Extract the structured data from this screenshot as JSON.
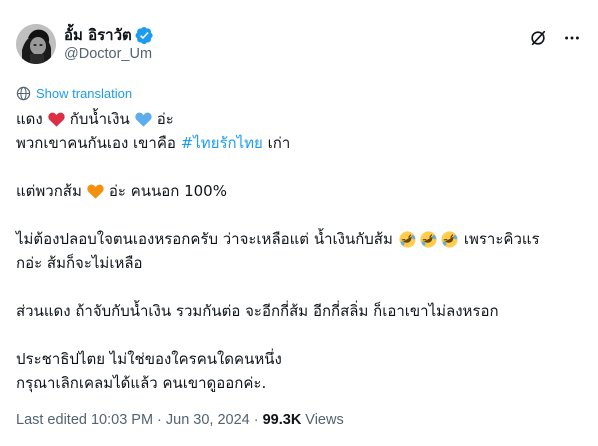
{
  "author": {
    "display_name": "อั้ม อิราวัต",
    "handle": "@Doctor_Um"
  },
  "header_icons": [
    "verified-badge-icon",
    "grok-icon",
    "more-icon"
  ],
  "translate": {
    "label": "Show translation",
    "icon": "globe-icon"
  },
  "body": {
    "line1": {
      "a": "แดง",
      "b": "กับน้ำเงิน",
      "c": "อ่ะ"
    },
    "line2": {
      "a": "พวกเขาคนกันเอง เขาคือ",
      "hashtag": "#ไทยรักไทย",
      "b": "เก่า"
    },
    "line3": {
      "a": "แต่พวกส้ม",
      "b": "อ่ะ คนนอก 100%"
    },
    "line4": {
      "a": "ไม่ต้องปลอบใจตนเองหรอกครับ ว่าจะเหลือแต่ น้ำเงินกับส้ม",
      "b": "เพราะคิวแร"
    },
    "line5": {
      "a": "กอ่ะ ส้มก็จะไม่เหลือ"
    },
    "line6": {
      "a": "ส่วนแดง ถ้าจับกับน้ำเงิน รวมกันต่อ จะอีกกี่ส้ม อีกกี่สลิ่ม ก็เอาเขาไม่ลงหรอก"
    },
    "line7": {
      "a": "ประชาธิปไตย ไม่ใช่ของใครคนใดคนหนึ่ง"
    },
    "line8": {
      "a": "กรุณาเลิกเคลมได้แล้ว คนเขาดูออกค่ะ."
    }
  },
  "emojis": {
    "red_heart": "red-heart",
    "blue_heart": "blue-heart",
    "orange_heart": "orange-heart",
    "rofl": "rolling-on-the-floor-laughing"
  },
  "meta": {
    "edited": "Last edited 10:03 PM",
    "separator": "·",
    "date": "Jun 30, 2024",
    "views_count": "99.3K",
    "views_label": "Views"
  },
  "colors": {
    "link": "#1d9bf0",
    "text": "#0f1419",
    "secondary": "#536471",
    "red_heart": "#dd2e44",
    "blue_heart": "#5dadec",
    "orange_heart": "#f4900c"
  }
}
